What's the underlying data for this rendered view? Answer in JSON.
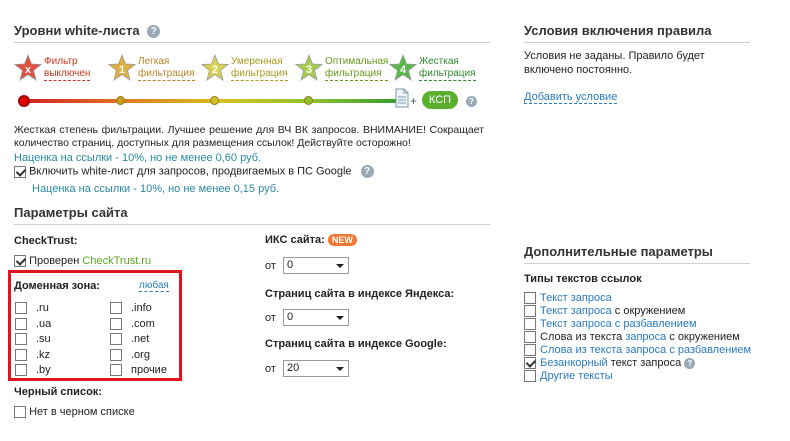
{
  "levels": {
    "title": "Уровни white-листа",
    "items": [
      {
        "num": "x",
        "line1": "Фильтр",
        "line2": "выключен",
        "color": "#c83a1e",
        "star": "#e05040"
      },
      {
        "num": "1",
        "line1": "Легкая",
        "line2": "фильтрация",
        "color": "#b8862a",
        "star": "#e0b040"
      },
      {
        "num": "2",
        "line1": "Умеренная",
        "line2": "фильтрация",
        "color": "#a89a1e",
        "star": "#d8d050"
      },
      {
        "num": "3",
        "line1": "Оптимальная",
        "line2": "фильтрация",
        "color": "#6a9a20",
        "star": "#a8cc50"
      },
      {
        "num": "4",
        "line1": "Жесткая",
        "line2": "фильтрация",
        "color": "#2e8a2e",
        "star": "#58b848"
      }
    ],
    "ksp_label": "КСП",
    "plus": "+",
    "description": "Жесткая степень фильтрации. Лучшее решение для ВЧ ВК запросов. ВНИМАНИЕ! Сокращает количество страниц, доступных для размещения ссылок! Действуйте осторожно!",
    "markup1": "Наценка на ссылки - 10%, но не менее 0,60 руб.",
    "google_checkbox": "Включить white-лист для запросов, продвигаемых в ПС Google",
    "markup2": "Наценка на ссылки - 10%, но не менее 0,15 руб."
  },
  "conditions": {
    "title": "Условия включения правила",
    "text1": "Условия не заданы. Правило будет",
    "text2": "включено постоянно.",
    "add_link": "Добавить условие"
  },
  "site": {
    "title": "Параметры сайта",
    "checktrust_label": "CheckTrust:",
    "checked_by": "Проверен",
    "checktrust_link": "CheckTrust.ru",
    "domain_label": "Доменная зона:",
    "domain_any": "любая",
    "domains_left": [
      ".ru",
      ".ua",
      ".su",
      ".kz",
      ".by"
    ],
    "domains_right": [
      ".info",
      ".com",
      ".net",
      ".org",
      "прочие"
    ],
    "blacklist_label": "Черный список:",
    "blacklist_option": "Нет в черном списке",
    "iks_label": "ИКС сайта:",
    "iks_badge": "NEW",
    "from": "от",
    "iks_value": "0",
    "yandex_label": "Страниц сайта в индексе Яндекса:",
    "yandex_value": "0",
    "google_label": "Страниц сайта в индексе Google:",
    "google_value": "20"
  },
  "extra": {
    "title": "Дополнительные параметры",
    "types_label": "Типы текстов ссылок",
    "options": [
      {
        "parts": [
          {
            "t": "Текст запроса",
            "c": "link"
          }
        ],
        "checked": false
      },
      {
        "parts": [
          {
            "t": "Текст запроса",
            "c": "link"
          },
          {
            "t": " с окружением",
            "c": "plain"
          }
        ],
        "checked": false
      },
      {
        "parts": [
          {
            "t": "Текст запроса с разбавлением",
            "c": "link"
          }
        ],
        "checked": false
      },
      {
        "parts": [
          {
            "t": "Слова из текста ",
            "c": "plain"
          },
          {
            "t": "запроса",
            "c": "link"
          },
          {
            "t": " с окружением",
            "c": "plain"
          }
        ],
        "checked": false
      },
      {
        "parts": [
          {
            "t": "Слова из текста запроса с разбавлением",
            "c": "link"
          }
        ],
        "checked": false
      },
      {
        "parts": [
          {
            "t": "Безанкорный",
            "c": "link"
          },
          {
            "t": " текст запроса",
            "c": "plain"
          }
        ],
        "checked": true,
        "help": true
      },
      {
        "parts": [
          {
            "t": "Другие тексты",
            "c": "link"
          }
        ],
        "checked": false
      }
    ]
  }
}
